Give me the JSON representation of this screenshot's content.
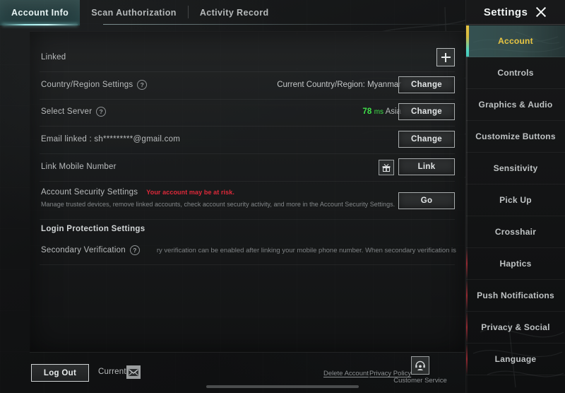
{
  "tabs": [
    {
      "label": "Account Info",
      "active": true
    },
    {
      "label": "Scan Authorization",
      "active": false
    },
    {
      "label": "Activity Record",
      "active": false
    }
  ],
  "account": {
    "linked": {
      "label": "Linked",
      "add_icon": "plus-icon"
    },
    "country_region": {
      "label": "Country/Region Settings",
      "help_icon": "question-mark-icon",
      "value": "Current Country/Region: Myanmar",
      "button": "Change"
    },
    "select_server": {
      "label": "Select Server",
      "help_icon": "question-mark-icon",
      "ping": "78",
      "ping_unit": "ms",
      "region": "Asia",
      "ping_color": "#3fe04a",
      "button": "Change"
    },
    "email": {
      "label": "Email linked : sh*********@gmail.com",
      "button": "Change"
    },
    "mobile": {
      "label": "Link Mobile Number",
      "gift_icon": "gift-box-icon",
      "button": "Link"
    },
    "security": {
      "label": "Account Security Settings",
      "warning": "Your account may be at risk.",
      "warning_color": "#e0293a",
      "description": "Manage trusted devices, remove linked accounts, check account security activity, and more in the Account Security Settings.",
      "button": "Go"
    },
    "login_protection": {
      "title": "Login Protection Settings",
      "secondary_verification": {
        "label": "Secondary Verification",
        "help_icon": "question-mark-icon",
        "marquee": "condary verification can be enabled after linking your mobile phone number. When secondary verification is enabled, nor"
      }
    }
  },
  "footer": {
    "log_out": "Log Out",
    "current": "Current",
    "mail_icon": "envelope-icon",
    "delete_account": "Delete Account",
    "privacy_policy": "Privacy Policy",
    "customer_service": "Customer Service",
    "customer_service_icon": "headset-support-icon"
  },
  "settings": {
    "title": "Settings",
    "close_icon": "close-x-icon",
    "items": [
      {
        "label": "Account",
        "active": true,
        "accent": "none"
      },
      {
        "label": "Controls",
        "active": false,
        "accent": "none"
      },
      {
        "label": "Graphics & Audio",
        "active": false,
        "accent": "none"
      },
      {
        "label": "Customize Buttons",
        "active": false,
        "accent": "none"
      },
      {
        "label": "Sensitivity",
        "active": false,
        "accent": "none"
      },
      {
        "label": "Pick Up",
        "active": false,
        "accent": "none"
      },
      {
        "label": "Crosshair",
        "active": false,
        "accent": "none"
      },
      {
        "label": "Haptics",
        "active": false,
        "accent": "red"
      },
      {
        "label": "Push Notifications",
        "active": false,
        "accent": "red"
      },
      {
        "label": "Privacy & Social",
        "active": false,
        "accent": "red"
      },
      {
        "label": "Language",
        "active": false,
        "accent": "red"
      }
    ]
  },
  "theme": {
    "accent_teal": "#9fe9e9",
    "accent_yellow": "#e8c542",
    "panel_bg": "#1a1c1d",
    "text_primary": "#c9c9c9"
  }
}
